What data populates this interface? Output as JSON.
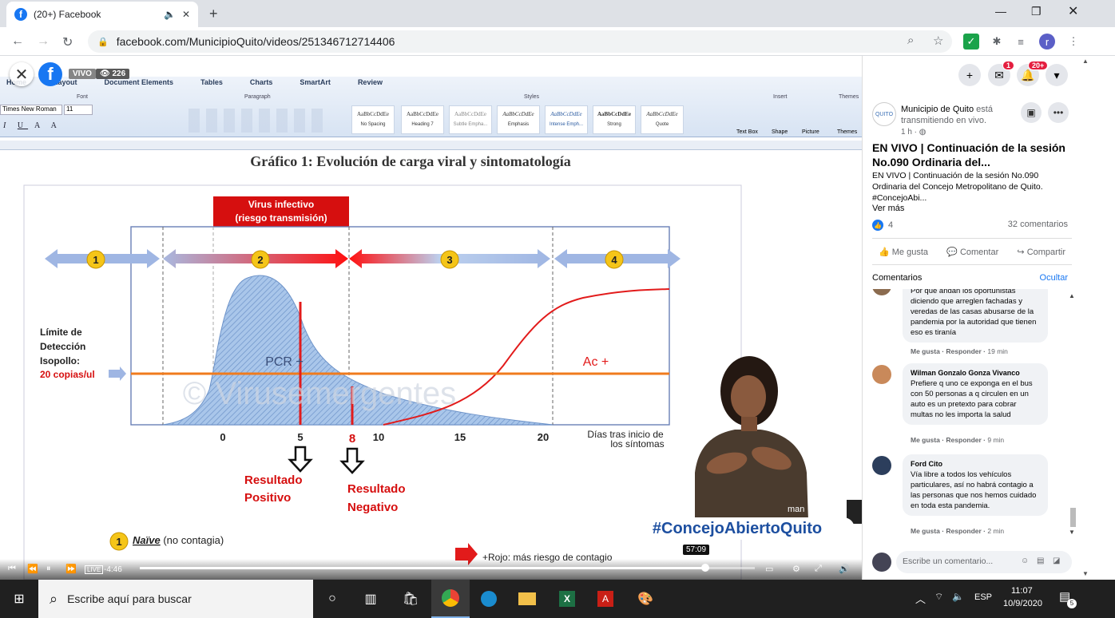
{
  "browser": {
    "tab_title": "(20+) Facebook",
    "url": "facebook.com/MunicipioQuito/videos/251346712714406"
  },
  "video": {
    "live_label": "VIVO",
    "viewer_count": "226",
    "ribbon_tabs": [
      "Home",
      "Layout",
      "Document Elements",
      "Tables",
      "Charts",
      "SmartArt",
      "Review"
    ],
    "ribbon_groups": [
      "Font",
      "Paragraph",
      "Styles",
      "Insert",
      "Themes"
    ],
    "font_name": "Times New Roman",
    "font_size": "11",
    "styles": [
      {
        "sample": "AaBbCcDdEe",
        "name": "No Spacing"
      },
      {
        "sample": "AaBbCcDdEe",
        "name": "Heading 7"
      },
      {
        "sample": "AaBbCcDdEe",
        "name": "Subtle Empha..."
      },
      {
        "sample": "AaBbCcDdEe",
        "name": "Emphasis"
      },
      {
        "sample": "AaBbCcDdEe",
        "name": "Intense Emph..."
      },
      {
        "sample": "AaBbCcDdEe",
        "name": "Strong"
      },
      {
        "sample": "AaBbCcDdEe",
        "name": "Quote"
      }
    ],
    "insert_items": [
      "Text Box",
      "Shape",
      "Picture",
      "Themes"
    ],
    "hashtag": "#ConcejoAbiertoQuito",
    "time_remaining": "-4:46",
    "hover_time": "57:09",
    "progress_fraction": 0.92,
    "interpreter_label": "man"
  },
  "slide": {
    "title": "Gráfico 1: Evolución de carga viral y sintomatología",
    "virus_box_l1": "Virus infectivo",
    "virus_box_l2": "(riesgo transmisión)",
    "phases": [
      "1",
      "2",
      "3",
      "4"
    ],
    "limit_l1": "Límite de",
    "limit_l2": "Detección",
    "limit_l3": "Isopollo:",
    "limit_l4": "20 copias/ul",
    "pcr_label": "PCR +",
    "ac_label": "Ac +",
    "watermark": "© Virusemergentes",
    "x_ticks": [
      "0",
      "5",
      "8",
      "10",
      "15",
      "20"
    ],
    "x_label_l1": "Días tras inicio de",
    "x_label_l2": "los síntomas",
    "result_pos_l1": "Resultado",
    "result_pos_l2": "Positivo",
    "result_neg_l1": "Resultado",
    "result_neg_l2": "Negativo",
    "legend_1_em": "Naïve",
    "legend_1_rest": " (no contagia)",
    "legend_red": "+Rojo: más riesgo de contagio"
  },
  "panel": {
    "messenger_badge": "1",
    "notif_badge": "20+",
    "author_logo": "QUITO",
    "author_name": "Municipio de Quito",
    "author_action": "está transmitiendo en vivo.",
    "post_time": "1 h",
    "post_title": "EN VIVO | Continuación de la sesión No.090 Ordinaria del...",
    "post_desc": "EN VIVO | Continuación de la sesión No.090 Ordinaria del Concejo Metropolitano de Quito. #ConcejoAbi...",
    "see_more": "Ver más",
    "like_count": "4",
    "comment_count": "32 comentarios",
    "action_like": "Me gusta",
    "action_comment": "Comentar",
    "action_share": "Compartir",
    "comments_header": "Comentarios",
    "hide_label": "Ocultar",
    "comments": [
      {
        "name": "",
        "text": "Por que andan los oportunistas diciendo que arreglen fachadas y veredas de las casas abusarse de la pandemia por la autoridad que tienen eso es tiranía",
        "meta_like": "Me gusta",
        "meta_reply": "Responder",
        "time": "19 min"
      },
      {
        "name": "Wilman Gonzalo Gonza Vivanco",
        "text": "Prefiere q uno ce exponga en el bus con 50 personas a q circulen en un auto es un pretexto para cobrar multas no les importa la salud",
        "meta_like": "Me gusta",
        "meta_reply": "Responder",
        "time": "9 min"
      },
      {
        "name": "Ford Cito",
        "text": "Vía libre a todos los vehículos particulares, así no habrá contagio a las personas que nos hemos cuidado en toda esta pandemia.",
        "meta_like": "Me gusta",
        "meta_reply": "Responder",
        "time": "2 min"
      }
    ],
    "compose_placeholder": "Escribe un comentario..."
  },
  "taskbar": {
    "search_placeholder": "Escribe aquí para buscar",
    "language": "ESP",
    "time": "11:07",
    "date": "10/9/2020",
    "notif_count": "5"
  }
}
